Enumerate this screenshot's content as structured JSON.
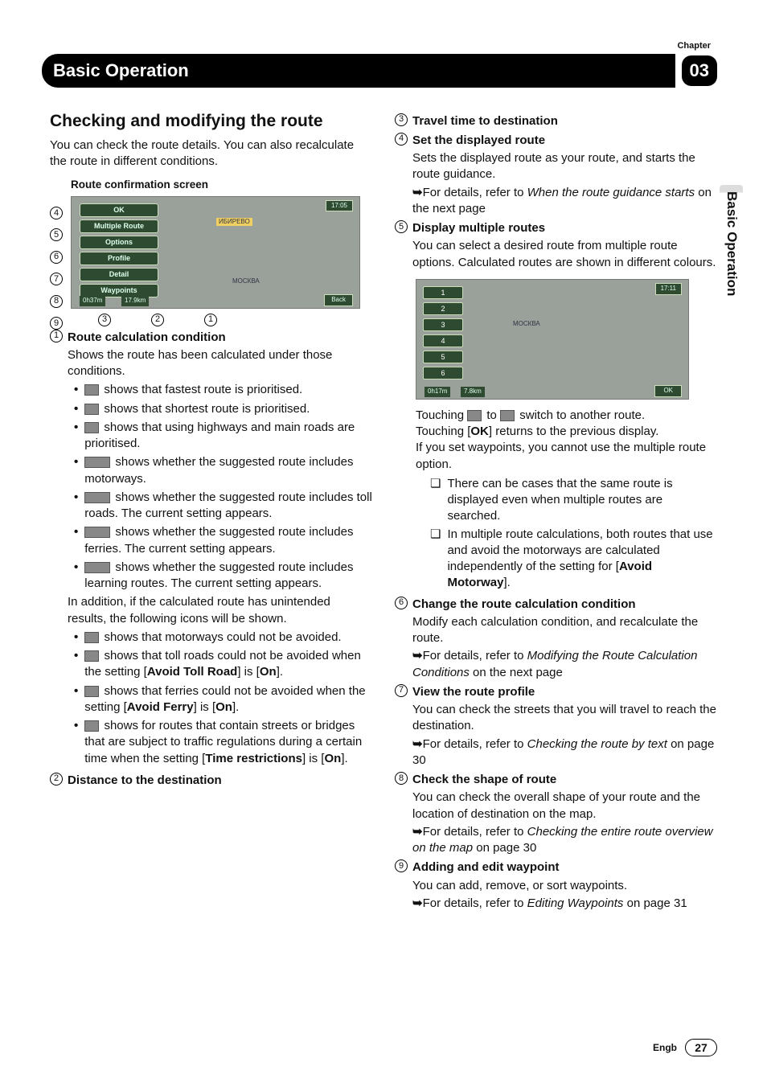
{
  "chapter_label": "Chapter",
  "chapter_num": "03",
  "section_title": "Basic Operation",
  "side_tab": "Basic Operation",
  "heading": "Checking and modifying the route",
  "intro": "You can check the route details. You can also recalculate the route in different conditions.",
  "confirm_title": "Route confirmation screen",
  "screenshot": {
    "buttons": [
      "OK",
      "Multiple Route",
      "Options",
      "Profile",
      "Detail",
      "Waypoints"
    ],
    "time_box": "17:05",
    "status_left": "0h37m",
    "status_dist": "17.9km",
    "back": "Back",
    "map_city": "МОСКВА",
    "map_dest": "ИБИРЕВО"
  },
  "left_labels_top": [
    "4",
    "5",
    "6",
    "7",
    "8",
    "9"
  ],
  "bottom_labels": [
    "3",
    "2",
    "1"
  ],
  "defs_left": [
    {
      "n": "1",
      "title": "Route calculation condition",
      "text": "Shows the route has been calculated under those conditions.",
      "bullets": [
        {
          "icons": 1,
          "t": "shows that fastest route is prioritised."
        },
        {
          "icons": 1,
          "t": "shows that shortest route is prioritised."
        },
        {
          "icons": 1,
          "t": "shows that using highways and main roads are prioritised."
        },
        {
          "icons": 2,
          "t": "shows whether the suggested route includes motorways."
        },
        {
          "icons": 2,
          "t": "shows whether the suggested route includes toll roads. The current setting appears."
        },
        {
          "icons": 2,
          "t": "shows whether the suggested route includes ferries. The current setting appears."
        },
        {
          "icons": 2,
          "t": "shows whether the suggested route includes learning routes. The current setting appears."
        }
      ],
      "extra": "In addition, if the calculated route has unintended results, the following icons will be shown.",
      "bullets2": [
        {
          "icons": 1,
          "t": "shows that motorways could not be avoided."
        },
        {
          "icons": 1,
          "pre": "shows that toll roads could not be avoided when the setting [",
          "b": "Avoid Toll Road",
          "mid": "] is [",
          "b2": "On",
          "post": "]."
        },
        {
          "icons": 1,
          "pre": "shows that ferries could not be avoided when the setting [",
          "b": "Avoid Ferry",
          "mid": "] is [",
          "b2": "On",
          "post": "]."
        },
        {
          "icons": 1,
          "pre": "shows for routes that contain streets or bridges that are subject to traffic regulations during a certain time when the setting [",
          "b": "Time restrictions",
          "mid": "] is [",
          "b2": "On",
          "post": "]."
        }
      ]
    },
    {
      "n": "2",
      "title": "Distance to the destination"
    }
  ],
  "defs_right_top": [
    {
      "n": "3",
      "title": "Travel time to destination"
    },
    {
      "n": "4",
      "title": "Set the displayed route",
      "text": "Sets the displayed route as your route, and starts the route guidance.",
      "ref": "For details, refer to ",
      "ref_i": "When the route guidance starts",
      "ref_post": " on the next page"
    },
    {
      "n": "5",
      "title": "Display multiple routes",
      "text": "You can select a desired route from multiple route options. Calculated routes are shown in different colours."
    }
  ],
  "multi_screenshot": {
    "rows": [
      "1",
      "2",
      "3",
      "4",
      "5",
      "6"
    ],
    "time": "17:11",
    "status_left": "0h17m",
    "status_dist": "7.8km",
    "city": "МОСКВА",
    "ok": "OK"
  },
  "multi_para": {
    "p1a": "Touching ",
    "p1b": " to ",
    "p1c": " switch to another route.",
    "p2a": "Touching [",
    "p2b": "OK",
    "p2c": "] returns to the previous display.",
    "p3": "If you set waypoints, you cannot use the multiple route option.",
    "notes": [
      "There can be cases that the same route is displayed even when multiple routes are searched.",
      "In multiple route calculations, both routes that use and avoid the motorways are calculated independently of the setting for [Avoid Motorway]."
    ],
    "note2_pre": "In multiple route calculations, both routes that use and avoid the motorways are calculated independently of the setting for [",
    "note2_b": "Avoid Motorway",
    "note2_post": "]."
  },
  "defs_right_bottom": [
    {
      "n": "6",
      "title": "Change the route calculation condition",
      "text": "Modify each calculation condition, and recalculate the route.",
      "ref": "For details, refer to ",
      "ref_i": "Modifying the Route Calculation Conditions",
      "ref_post": " on the next page"
    },
    {
      "n": "7",
      "title": "View the route profile",
      "text": "You can check the streets that you will travel to reach the destination.",
      "ref": "For details, refer to ",
      "ref_i": "Checking the route by text",
      "ref_post": " on page 30"
    },
    {
      "n": "8",
      "title": "Check the shape of route",
      "text": "You can check the overall shape of your route and the location of destination on the map.",
      "ref": "For details, refer to ",
      "ref_i": "Checking the entire route overview on the map",
      "ref_post": " on page 30"
    },
    {
      "n": "9",
      "title": "Adding and edit waypoint",
      "text": "You can add, remove, or sort waypoints.",
      "ref": "For details, refer to ",
      "ref_i": "Editing Waypoints",
      "ref_post": " on page 31"
    }
  ],
  "footer_lang": "Engb",
  "footer_page": "27"
}
